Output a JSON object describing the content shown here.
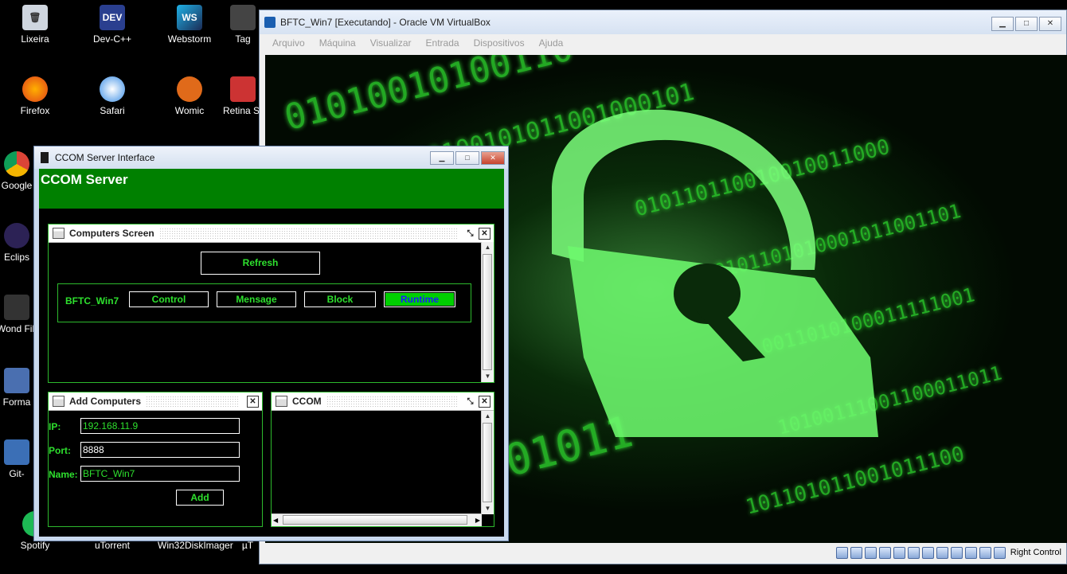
{
  "desktop": {
    "icons": [
      {
        "label": "Lixeira",
        "glyph": "trash-icon"
      },
      {
        "label": "Dev-C++",
        "glyph": "devcpp-icon"
      },
      {
        "label": "Webstorm",
        "glyph": "webstorm-icon"
      },
      {
        "label": "Tag",
        "glyph": "app-icon"
      },
      {
        "label": "Firefox",
        "glyph": "firefox-icon"
      },
      {
        "label": "Safari",
        "glyph": "safari-icon"
      },
      {
        "label": "Womic",
        "glyph": "womic-icon"
      },
      {
        "label": "Retina Securi",
        "glyph": "retina-icon"
      },
      {
        "label": "Google",
        "glyph": "chrome-icon"
      },
      {
        "label": "Eclips",
        "glyph": "eclipse-icon"
      },
      {
        "label": "Wond Filr",
        "glyph": "wondershare-icon"
      },
      {
        "label": "Forma",
        "glyph": "format-icon"
      },
      {
        "label": "Git-",
        "glyph": "git-icon"
      },
      {
        "label": "Spotify",
        "glyph": "spotify-icon"
      },
      {
        "label": "uTorrent",
        "glyph": "utorrent-icon"
      },
      {
        "label": "Win32DiskImager",
        "glyph": "disk-icon"
      },
      {
        "label": "µT",
        "glyph": "app-icon"
      }
    ]
  },
  "vbox": {
    "title": "BFTC_Win7 [Executando] - Oracle VM VirtualBox",
    "menu": [
      "Arquivo",
      "Máquina",
      "Visualizar",
      "Entrada",
      "Dispositivos",
      "Ajuda"
    ],
    "status_right": "Right Control"
  },
  "ccom": {
    "window_title": "CCOM Server Interface",
    "header_title": "CCOM Server",
    "computers_screen": {
      "title": "Computers Screen",
      "refresh_label": "Refresh",
      "computer": {
        "name": "BFTC_Win7",
        "control_label": "Control",
        "message_label": "Mensage",
        "block_label": "Block",
        "runtime_label": "Runtime"
      }
    },
    "add_computers": {
      "title": "Add Computers",
      "ip_label": "IP:",
      "ip_value": "192.168.11.9",
      "port_label": "Port:",
      "port_value": "8888",
      "name_label": "Name:",
      "name_value": "BFTC_Win7",
      "add_label": "Add"
    },
    "log": {
      "title": "CCOM"
    }
  },
  "colors": {
    "green_text": "#2ee02e",
    "header_green": "#008000",
    "runtime_bg": "#00d000"
  }
}
